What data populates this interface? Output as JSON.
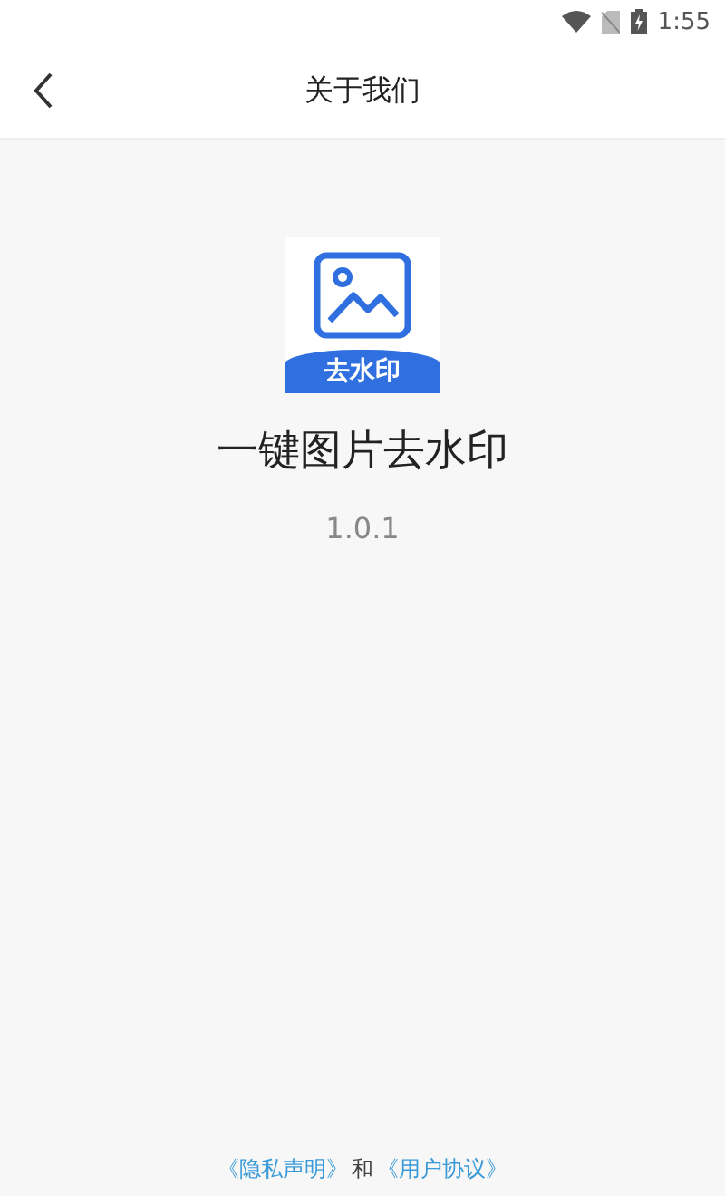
{
  "status_bar": {
    "time": "1:55"
  },
  "header": {
    "title": "关于我们"
  },
  "app": {
    "icon_label": "去水印",
    "name": "一键图片去水印",
    "version": "1.0.1"
  },
  "footer": {
    "links": [
      "《隐私声明》",
      "《用户协议》"
    ],
    "joiner": "和"
  }
}
